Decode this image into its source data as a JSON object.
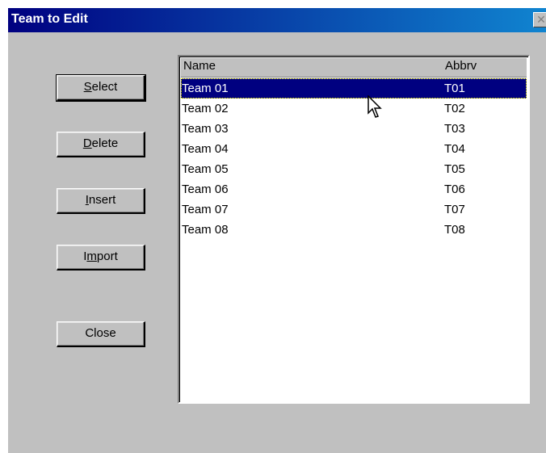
{
  "window": {
    "title": "Team to Edit",
    "close_glyph": "✕"
  },
  "buttons": {
    "select": {
      "pre": "",
      "access": "S",
      "post": "elect"
    },
    "delete": {
      "pre": "",
      "access": "D",
      "post": "elete"
    },
    "insert": {
      "pre": "",
      "access": "I",
      "post": "nsert"
    },
    "import": {
      "pre": "I",
      "access": "m",
      "post": "port"
    },
    "close": {
      "label": "Close"
    }
  },
  "table": {
    "headers": {
      "name": "Name",
      "abbrv": "Abbrv"
    },
    "rows": [
      {
        "name": "Team 01",
        "abbrv": "T01",
        "selected": true
      },
      {
        "name": "Team 02",
        "abbrv": "T02"
      },
      {
        "name": "Team 03",
        "abbrv": "T03"
      },
      {
        "name": "Team 04",
        "abbrv": "T04"
      },
      {
        "name": "Team 05",
        "abbrv": "T05"
      },
      {
        "name": "Team 06",
        "abbrv": "T06"
      },
      {
        "name": "Team 07",
        "abbrv": "T07"
      },
      {
        "name": "Team 08",
        "abbrv": "T08"
      }
    ]
  },
  "colors": {
    "title_start": "#000080",
    "title_end": "#1084d0",
    "face": "#c0c0c0",
    "selection": "#000080"
  },
  "icons": {
    "pointer": "mouse-pointer-icon"
  }
}
